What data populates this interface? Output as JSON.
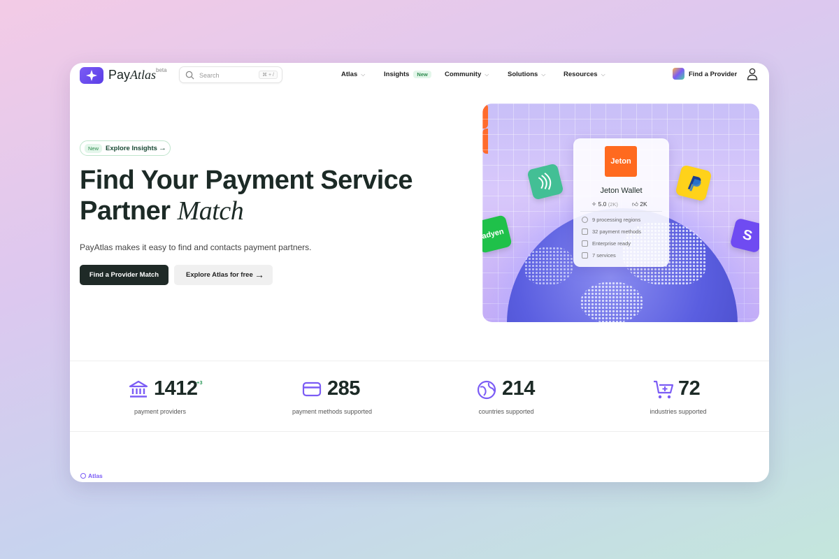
{
  "brand": {
    "name_plain": "Pay",
    "name_italic": "Atlas",
    "badge": "beta"
  },
  "search": {
    "placeholder": "Search",
    "shortcut": "⌘ + /"
  },
  "nav": {
    "items": [
      {
        "label": "Atlas"
      },
      {
        "label": "Insights",
        "badge": "New"
      },
      {
        "label": "Community"
      },
      {
        "label": "Solutions"
      },
      {
        "label": "Resources"
      }
    ],
    "find_provider": "Find a Provider"
  },
  "hero": {
    "pill_new": "New",
    "pill_text": "Explore Insights",
    "title_line1": "Find Your Payment Service",
    "title_line2": "Partner",
    "title_italic": "Match",
    "subtitle": "PayAtlas makes it easy to find and contacts payment partners.",
    "primary_button": "Find a Provider Match",
    "secondary_button": "Explore Atlas for free"
  },
  "provider_card": {
    "logo_text": "Jeton",
    "name": "Jeton Wallet",
    "rating": "5.0",
    "rating_count": "(2K)",
    "likes": "2K",
    "features": [
      {
        "icon": "globe-icon",
        "text": "9 processing regions"
      },
      {
        "icon": "grid-icon",
        "text": "32 payment methods"
      },
      {
        "icon": "building-icon",
        "text": "Enterprise ready"
      },
      {
        "icon": "briefcase-icon",
        "text": "7 services"
      }
    ],
    "tiles": {
      "adyen": "adyen",
      "stripe": "S"
    }
  },
  "stats": [
    {
      "icon": "bank-icon",
      "value": "1412",
      "delta": "+3",
      "label": "payment providers"
    },
    {
      "icon": "card-icon",
      "value": "285",
      "label": "payment methods supported"
    },
    {
      "icon": "globe-icon",
      "value": "214",
      "label": "countries supported"
    },
    {
      "icon": "cart-icon",
      "value": "72",
      "label": "industries supported"
    }
  ],
  "section_label": "Atlas",
  "colors": {
    "accent": "#7b5cf5",
    "primary_button": "#1f2a27",
    "new_badge": "#2d8a4e",
    "jeton": "#ff6a1f"
  }
}
